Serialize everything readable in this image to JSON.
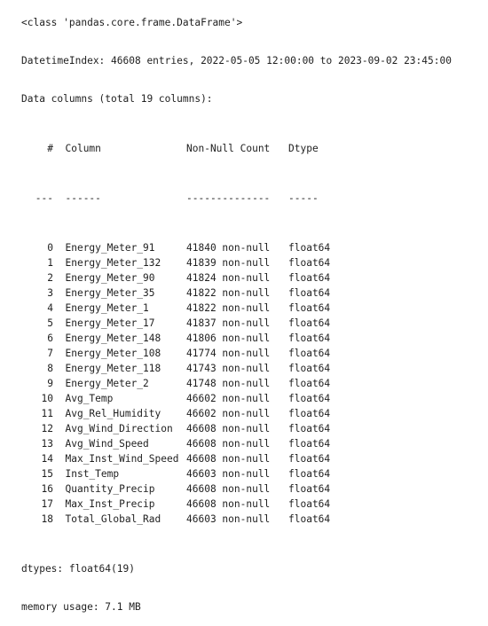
{
  "header": {
    "class_line": "<class 'pandas.core.frame.DataFrame'>",
    "index_line": "DatetimeIndex: 46608 entries, 2022-05-05 12:00:00 to 2023-09-02 23:45:00",
    "columns_line": "Data columns (total 19 columns):"
  },
  "table": {
    "headers": {
      "num": " #",
      "column": "Column",
      "count": "Non-Null Count",
      "dtype": "Dtype"
    },
    "separators": {
      "num": "---",
      "column": "------",
      "count": "--------------",
      "dtype": "-----"
    },
    "rows": [
      {
        "num": "0",
        "column": "Energy_Meter_91",
        "count": "41840 non-null",
        "dtype": "float64"
      },
      {
        "num": "1",
        "column": "Energy_Meter_132",
        "count": "41839 non-null",
        "dtype": "float64"
      },
      {
        "num": "2",
        "column": "Energy_Meter_90",
        "count": "41824 non-null",
        "dtype": "float64"
      },
      {
        "num": "3",
        "column": "Energy_Meter_35",
        "count": "41822 non-null",
        "dtype": "float64"
      },
      {
        "num": "4",
        "column": "Energy_Meter_1",
        "count": "41822 non-null",
        "dtype": "float64"
      },
      {
        "num": "5",
        "column": "Energy_Meter_17",
        "count": "41837 non-null",
        "dtype": "float64"
      },
      {
        "num": "6",
        "column": "Energy_Meter_148",
        "count": "41806 non-null",
        "dtype": "float64"
      },
      {
        "num": "7",
        "column": "Energy_Meter_108",
        "count": "41774 non-null",
        "dtype": "float64"
      },
      {
        "num": "8",
        "column": "Energy_Meter_118",
        "count": "41743 non-null",
        "dtype": "float64"
      },
      {
        "num": "9",
        "column": "Energy_Meter_2",
        "count": "41748 non-null",
        "dtype": "float64"
      },
      {
        "num": "10",
        "column": "Avg_Temp",
        "count": "46602 non-null",
        "dtype": "float64"
      },
      {
        "num": "11",
        "column": "Avg_Rel_Humidity",
        "count": "46602 non-null",
        "dtype": "float64"
      },
      {
        "num": "12",
        "column": "Avg_Wind_Direction",
        "count": "46608 non-null",
        "dtype": "float64"
      },
      {
        "num": "13",
        "column": "Avg_Wind_Speed",
        "count": "46608 non-null",
        "dtype": "float64"
      },
      {
        "num": "14",
        "column": "Max_Inst_Wind_Speed",
        "count": "46608 non-null",
        "dtype": "float64"
      },
      {
        "num": "15",
        "column": "Inst_Temp",
        "count": "46603 non-null",
        "dtype": "float64"
      },
      {
        "num": "16",
        "column": "Quantity_Precip",
        "count": "46608 non-null",
        "dtype": "float64"
      },
      {
        "num": "17",
        "column": "Max_Inst_Precip",
        "count": "46608 non-null",
        "dtype": "float64"
      },
      {
        "num": "18",
        "column": "Total_Global_Rad",
        "count": "46603 non-null",
        "dtype": "float64"
      }
    ]
  },
  "footer": {
    "dtypes_line": "dtypes: float64(19)",
    "memory_line": "memory usage: 7.1 MB"
  }
}
